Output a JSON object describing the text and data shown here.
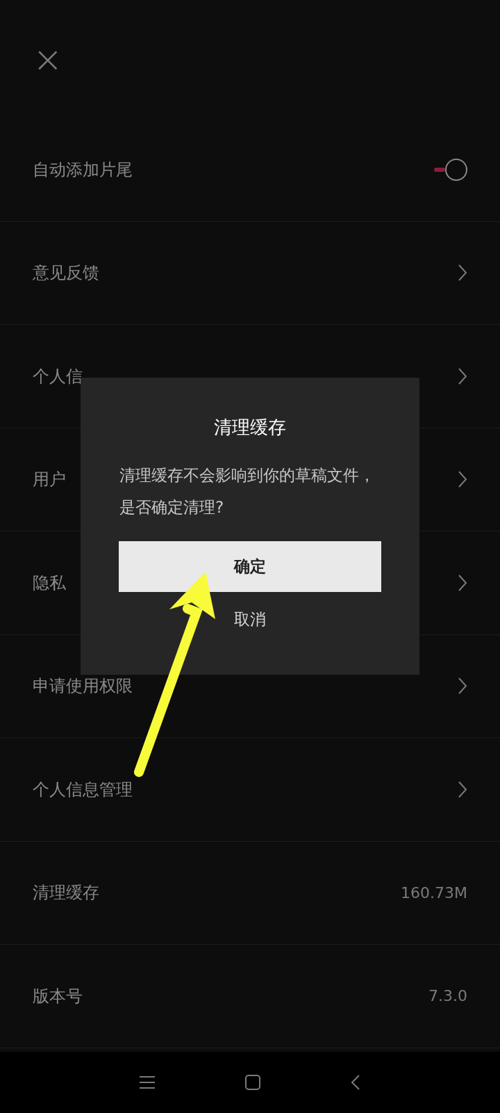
{
  "header": {
    "close": "×"
  },
  "rows": [
    {
      "kind": "toggle",
      "label": "自动添加片尾",
      "on": true
    },
    {
      "kind": "link",
      "label": "意见反馈"
    },
    {
      "kind": "link",
      "label": "个人信"
    },
    {
      "kind": "link",
      "label": "用户"
    },
    {
      "kind": "link",
      "label": "隐私"
    },
    {
      "kind": "link",
      "label": "申请使用权限"
    },
    {
      "kind": "link",
      "label": "个人信息管理"
    },
    {
      "kind": "value",
      "label": "清理缓存",
      "value": "160.73M"
    },
    {
      "kind": "value",
      "label": "版本号",
      "value": "7.3.0"
    }
  ],
  "dialog": {
    "title": "清理缓存",
    "message": "清理缓存不会影响到你的草稿文件，是否确定清理?",
    "confirm": "确定",
    "cancel": "取消"
  }
}
